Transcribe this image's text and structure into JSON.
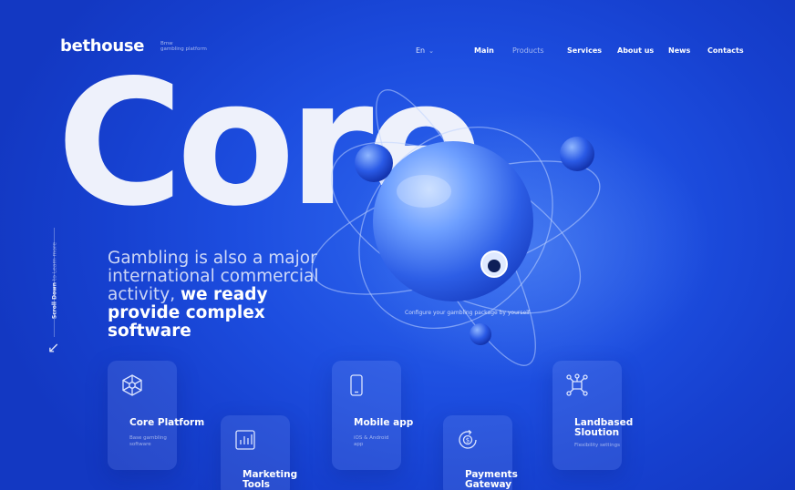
{
  "header": {
    "logo": "bethouse",
    "tagline_line1": "Bmw",
    "tagline_line2": "gambling platform",
    "language": "En",
    "nav": [
      "Main",
      "Products",
      "Services",
      "About us",
      "News",
      "Contacts"
    ],
    "active_nav": "Products"
  },
  "hero": {
    "word": "Core",
    "headline_regular": "Gambling is also a major international commercial activity,",
    "headline_bold": "we ready provide complex software",
    "configure_text": "Configure your gambling package by yourself",
    "scroll_bold": "Scroll Down",
    "scroll_rest": "to Learn more"
  },
  "cards": [
    {
      "title": "Core Platform",
      "desc": "Base gambling software",
      "icon": "network-icon"
    },
    {
      "title": "Marketing Tools",
      "desc": "",
      "icon": "chart-icon"
    },
    {
      "title": "Mobile app",
      "desc": "iOS & Android app",
      "icon": "phone-icon"
    },
    {
      "title": "Payments Gateway",
      "desc": "",
      "icon": "payment-icon"
    },
    {
      "title": "Landbased Sloution",
      "desc": "Flexibility settings",
      "icon": "hub-icon"
    }
  ],
  "colors": {
    "background": "#1d4ee0",
    "accent": "#ffffff",
    "hero_word": "#eef1fb"
  }
}
